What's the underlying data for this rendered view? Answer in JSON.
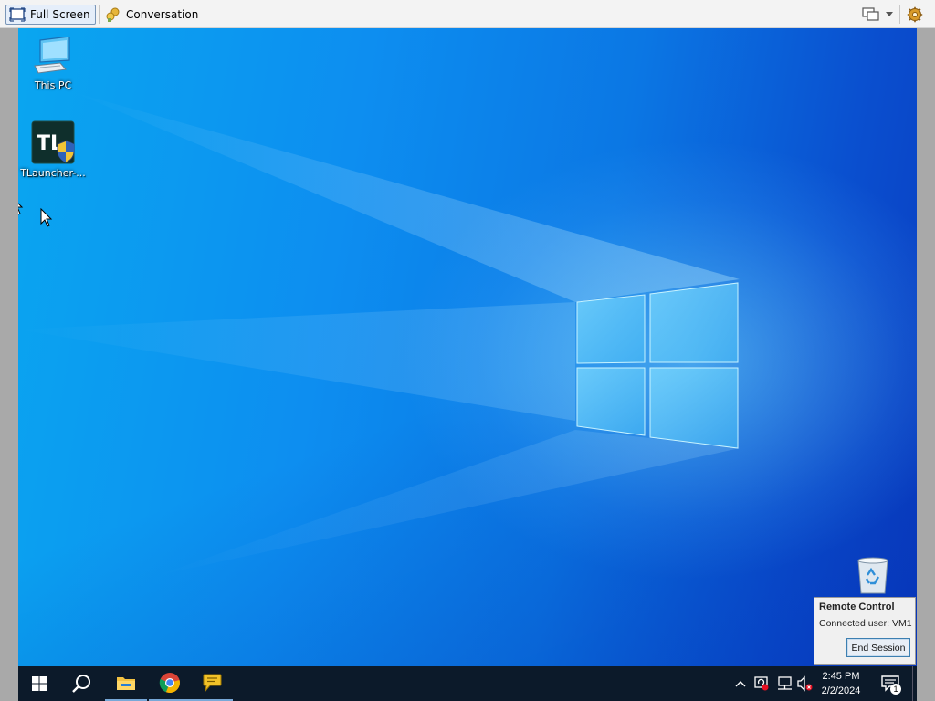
{
  "toolbar": {
    "fullscreen_label": "Full Screen",
    "conversation_label": "Conversation",
    "icons": [
      "fullscreen-icon",
      "conversation-icon",
      "monitor-icon",
      "dropdown-arrow-icon",
      "settings-gear-icon"
    ]
  },
  "desktop": {
    "icons": [
      {
        "label": "This PC",
        "icon": "this-pc-icon"
      },
      {
        "label": "TLauncher-...",
        "icon": "tlauncher-icon"
      },
      {
        "label": "",
        "icon": "recycle-bin-icon"
      }
    ]
  },
  "remote_popup": {
    "title": "Remote Control",
    "connected_user": "Connected user:  VM1",
    "end_button": "End Session"
  },
  "taskbar": {
    "apps": [
      "start-icon",
      "search-icon",
      "file-explorer-icon",
      "chrome-icon",
      "chat-icon"
    ],
    "tray_icons": [
      "show-hidden-icons-chevron",
      "security-icon",
      "network-icon",
      "volume-muted-icon"
    ],
    "time": "2:45 PM",
    "date": "2/2/2024",
    "notification_count": "1"
  },
  "colors": {
    "accent": "#0b77e4",
    "taskbar": "#0c1a2a",
    "toolbar": "#f3f3f3"
  }
}
